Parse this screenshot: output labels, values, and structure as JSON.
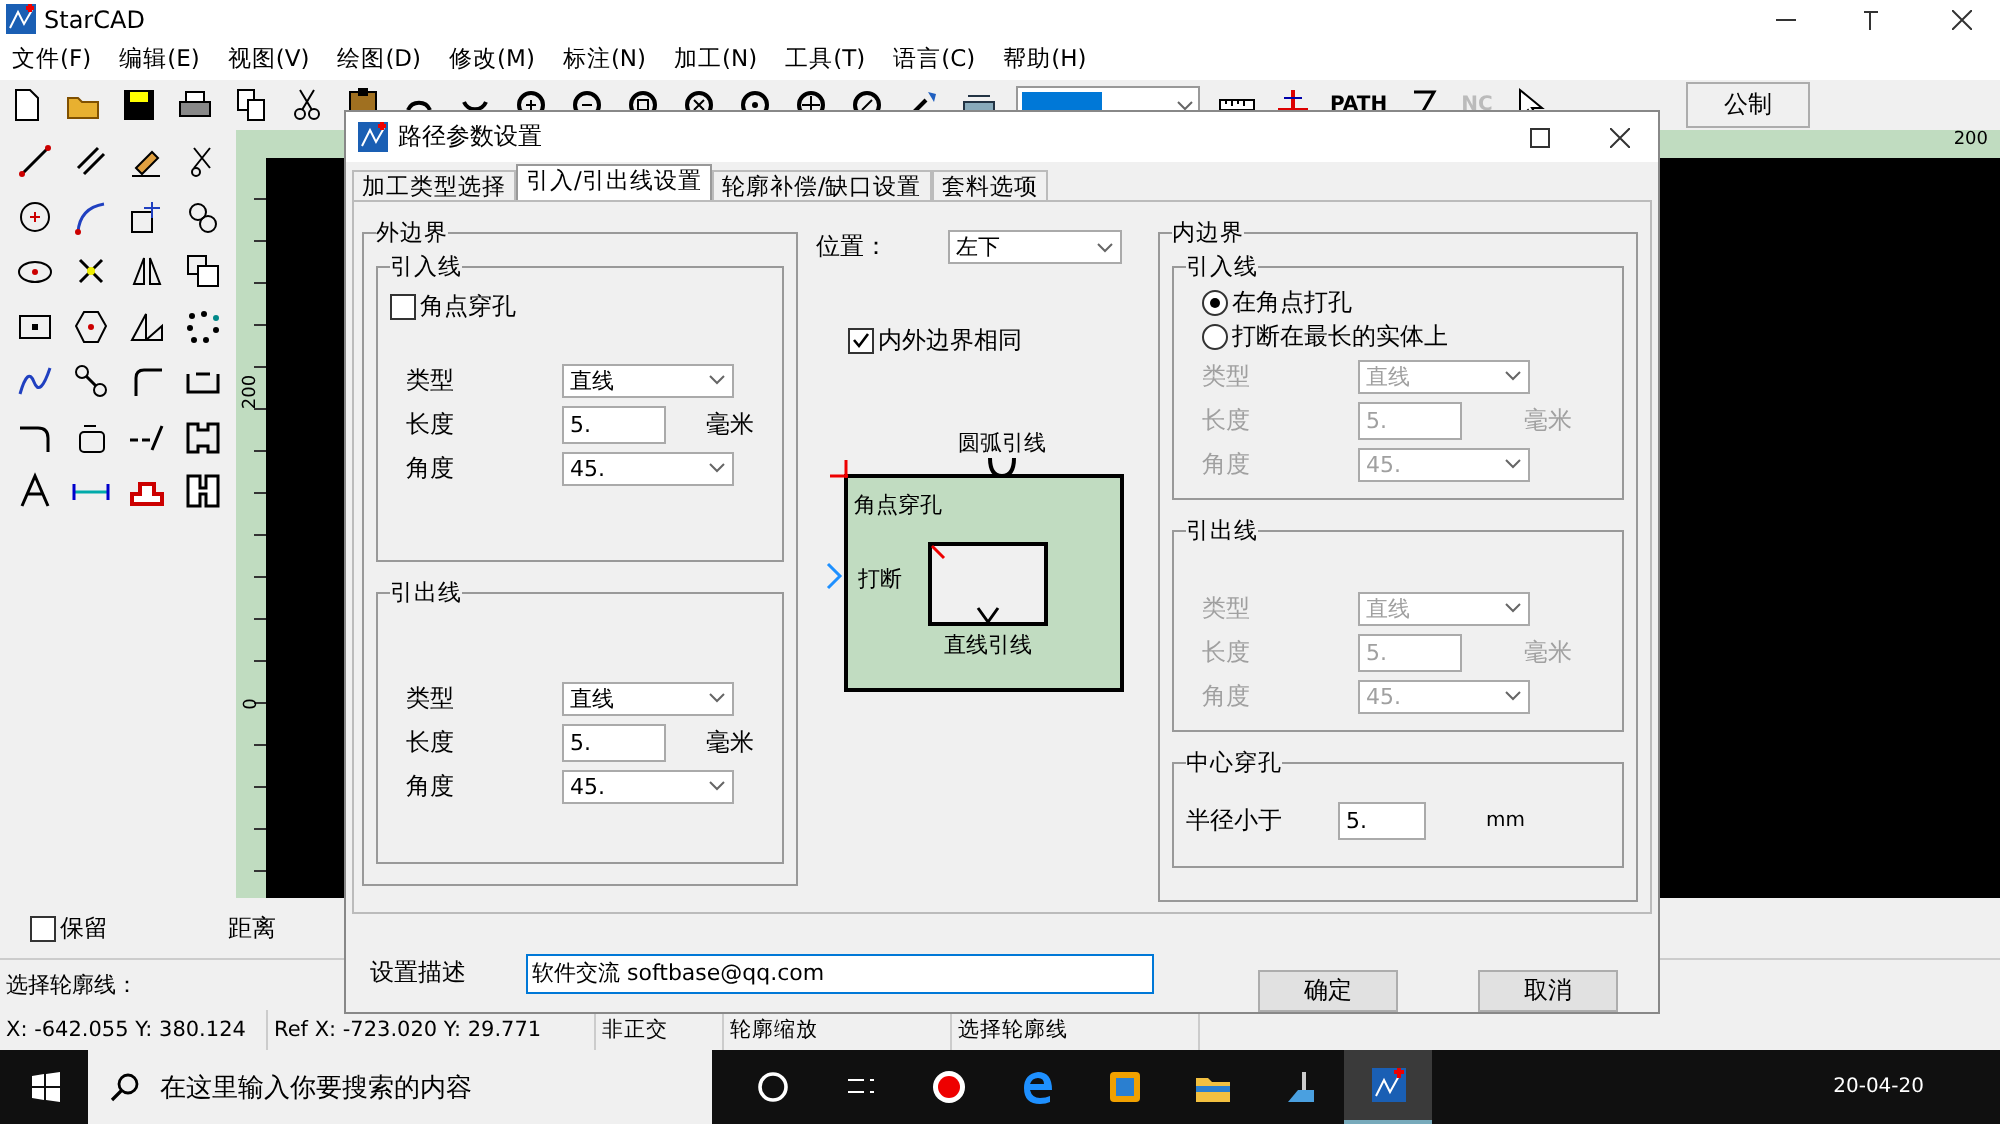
{
  "app": {
    "title": "StarCAD"
  },
  "menu": [
    "文件(F)",
    "编辑(E)",
    "视图(V)",
    "绘图(D)",
    "修改(M)",
    "标注(N)",
    "加工(N)",
    "工具(T)",
    "语言(C)",
    "帮助(H)"
  ],
  "toolbar": {
    "path_label": "PATH",
    "nc_label": "NC",
    "units_button": "公制"
  },
  "rulers": {
    "top_labels": [
      "200"
    ],
    "left_labels": [
      "200",
      "0"
    ]
  },
  "bottom_panel": {
    "keep": {
      "label": "保留",
      "checked": false
    },
    "distance_label": "距离"
  },
  "prompt": "选择轮廓线：",
  "status_bar": [
    "X: -642.055  Y: 380.124",
    "Ref X: -723.020  Y: 29.771",
    "非正交",
    "轮廓缩放",
    "选择轮廓线"
  ],
  "dialog": {
    "title": "路径参数设置",
    "tabs": [
      {
        "label": "加工类型选择",
        "selected": false
      },
      {
        "label": "引入/引出线设置",
        "selected": true
      },
      {
        "label": "轮廓补偿/缺口设置",
        "selected": false
      },
      {
        "label": "套料选项",
        "selected": false
      }
    ],
    "outer": {
      "title": "外边界",
      "lead_in": {
        "title": "引入线",
        "corner_pierce": {
          "label": "角点穿孔",
          "checked": false
        },
        "fields": [
          {
            "label": "类型",
            "kind": "select",
            "value": "直线"
          },
          {
            "label": "长度",
            "kind": "input",
            "value": "5.",
            "unit": "毫米"
          },
          {
            "label": "角度",
            "kind": "select",
            "value": "45."
          }
        ]
      },
      "lead_out": {
        "title": "引出线",
        "fields": [
          {
            "label": "类型",
            "kind": "select",
            "value": "直线"
          },
          {
            "label": "长度",
            "kind": "input",
            "value": "5.",
            "unit": "毫米"
          },
          {
            "label": "角度",
            "kind": "select",
            "value": "45."
          }
        ]
      }
    },
    "position": {
      "label": "位置：",
      "value": "左下"
    },
    "same_bounds": {
      "label": "内外边界相同",
      "checked": true
    },
    "diagram": {
      "arc_label": "圆弧引线",
      "corner_label": "角点穿孔",
      "break_label": "打断",
      "line_label": "直线引线"
    },
    "inner": {
      "title": "内边界",
      "lead_in": {
        "title": "引入线",
        "disabled": true,
        "options": [
          {
            "label": "在角点打孔",
            "selected": true
          },
          {
            "label": "打断在最长的实体上",
            "selected": false
          }
        ],
        "fields": [
          {
            "label": "类型",
            "kind": "select",
            "value": "直线"
          },
          {
            "label": "长度",
            "kind": "input",
            "value": "5.",
            "unit": "毫米"
          },
          {
            "label": "角度",
            "kind": "select",
            "value": "45."
          }
        ]
      },
      "lead_out": {
        "title": "引出线",
        "disabled": true,
        "fields": [
          {
            "label": "类型",
            "kind": "select",
            "value": "直线"
          },
          {
            "label": "长度",
            "kind": "input",
            "value": "5.",
            "unit": "毫米"
          },
          {
            "label": "角度",
            "kind": "select",
            "value": "45."
          }
        ]
      },
      "center_pierce": {
        "title": "中心穿孔",
        "label": "半径小于",
        "value": "5.",
        "unit": "mm"
      }
    },
    "description": {
      "label": "设置描述",
      "value": "软件交流 softbase@qq.com"
    },
    "buttons": [
      "确定",
      "取消"
    ]
  },
  "taskbar": {
    "search_placeholder": "在这里输入你要搜索的内容",
    "date": "20-04-20"
  }
}
